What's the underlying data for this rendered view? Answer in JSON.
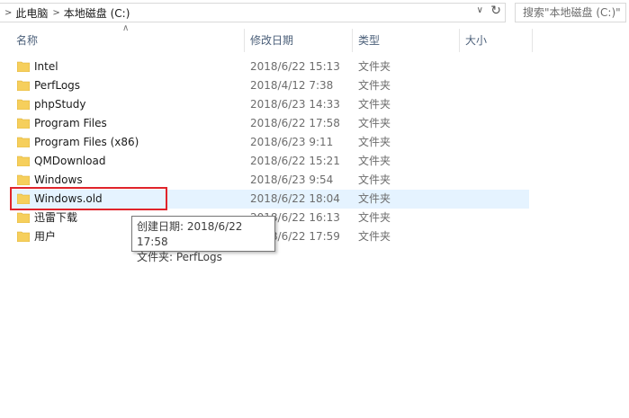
{
  "address_bar": {
    "breadcrumbs": [
      "此电脑",
      "本地磁盘 (C:)"
    ],
    "search_placeholder": "搜索\"本地磁盘 (C:)\""
  },
  "columns": {
    "name": "名称",
    "modified": "修改日期",
    "type": "类型",
    "size": "大小"
  },
  "files": [
    {
      "name": "Intel",
      "modified": "2018/6/22 15:13",
      "type": "文件夹"
    },
    {
      "name": "PerfLogs",
      "modified": "2018/4/12 7:38",
      "type": "文件夹"
    },
    {
      "name": "phpStudy",
      "modified": "2018/6/23 14:33",
      "type": "文件夹"
    },
    {
      "name": "Program Files",
      "modified": "2018/6/22 17:58",
      "type": "文件夹"
    },
    {
      "name": "Program Files (x86)",
      "modified": "2018/6/23 9:11",
      "type": "文件夹"
    },
    {
      "name": "QMDownload",
      "modified": "2018/6/22 15:21",
      "type": "文件夹"
    },
    {
      "name": "Windows",
      "modified": "2018/6/23 9:54",
      "type": "文件夹"
    },
    {
      "name": "Windows.old",
      "modified": "2018/6/22 18:04",
      "type": "文件夹"
    },
    {
      "name": "迅雷下载",
      "modified": "2018/6/22 16:13",
      "type": "文件夹"
    },
    {
      "name": "用户",
      "modified": "2018/6/22 17:59",
      "type": "文件夹"
    }
  ],
  "tooltip": {
    "line1": "创建日期: 2018/6/22 17:58",
    "line2": "文件夹: PerfLogs"
  },
  "colors": {
    "folder": "#f6cf5c",
    "selection": "#e5f3ff",
    "highlight_border": "#e0242b",
    "header_text": "#4c607a"
  }
}
